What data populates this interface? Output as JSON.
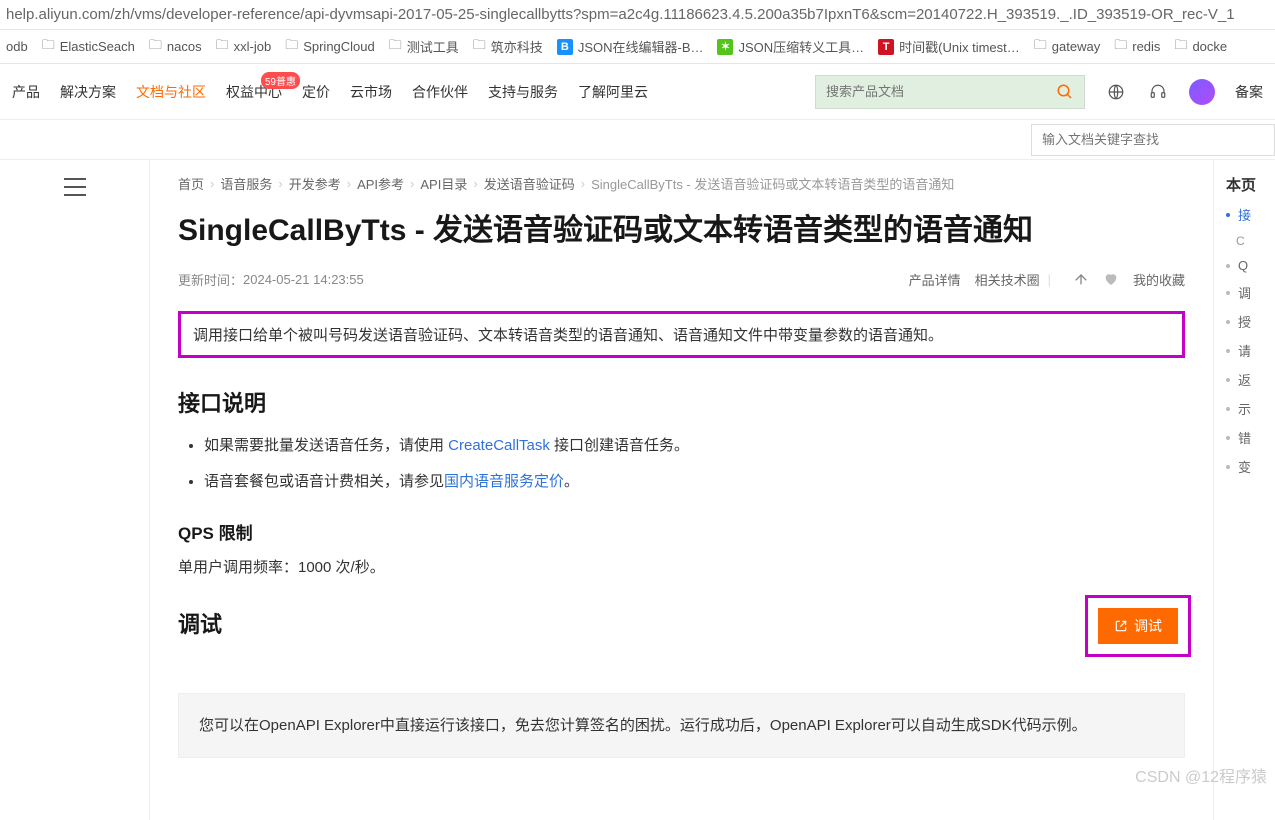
{
  "url": "help.aliyun.com/zh/vms/developer-reference/api-dyvmsapi-2017-05-25-singlecallbytts?spm=a2c4g.11186623.4.5.200a35b7IpxnT6&scm=20140722.H_393519._.ID_393519-OR_rec-V_1",
  "bookmarks": [
    "odb",
    "ElasticSeach",
    "nacos",
    "xxl-job",
    "SpringCloud",
    "测试工具",
    "筑亦科技",
    "JSON在线编辑器-B…",
    "JSON压缩转义工具…",
    "时间戳(Unix timest…",
    "gateway",
    "redis",
    "docke"
  ],
  "nav": {
    "items": [
      "产品",
      "解决方案",
      "文档与社区",
      "权益中心",
      "定价",
      "云市场",
      "合作伙伴",
      "支持与服务",
      "了解阿里云"
    ],
    "active_index": 2,
    "badge_index": 3,
    "badge_text": "59普惠",
    "search_placeholder": "搜索产品文档",
    "right_label": "备案"
  },
  "doc_search_placeholder": "输入文档关键字查找",
  "breadcrumb": [
    "首页",
    "语音服务",
    "开发参考",
    "API参考",
    "API目录",
    "发送语音验证码",
    "SingleCallByTts - 发送语音验证码或文本转语音类型的语音通知"
  ],
  "title": "SingleCallByTts - 发送语音验证码或文本转语音类型的语音通知",
  "meta": {
    "update_label": "更新时间：",
    "update_time": "2024-05-21 14:23:55",
    "actions": {
      "detail": "产品详情",
      "circle": "相关技术圈",
      "favorite": "我的收藏"
    }
  },
  "intro_box": "调用接口给单个被叫号码发送语音验证码、文本转语音类型的语音通知、语音通知文件中带变量参数的语音通知。",
  "sec_interface": {
    "heading": "接口说明",
    "bullets": [
      {
        "pre": "如果需要批量发送语音任务，请使用 ",
        "link": "CreateCallTask",
        "post": " 接口创建语音任务。"
      },
      {
        "pre": "语音套餐包或语音计费相关，请参见",
        "link": "国内语音服务定价",
        "post": "。"
      }
    ]
  },
  "sec_qps": {
    "heading": "QPS 限制",
    "text": "单用户调用频率：1000 次/秒。"
  },
  "sec_debug": {
    "heading": "调试",
    "button": "调试",
    "info": "您可以在OpenAPI Explorer中直接运行该接口，免去您计算签名的困扰。运行成功后，OpenAPI Explorer可以自动生成SDK代码示例。"
  },
  "outline": {
    "title": "本页",
    "items": [
      "接",
      "Q",
      "调",
      "授",
      "请",
      "返",
      "示",
      "错",
      "变"
    ],
    "sub": "C"
  },
  "watermark": "CSDN @12程序猿"
}
